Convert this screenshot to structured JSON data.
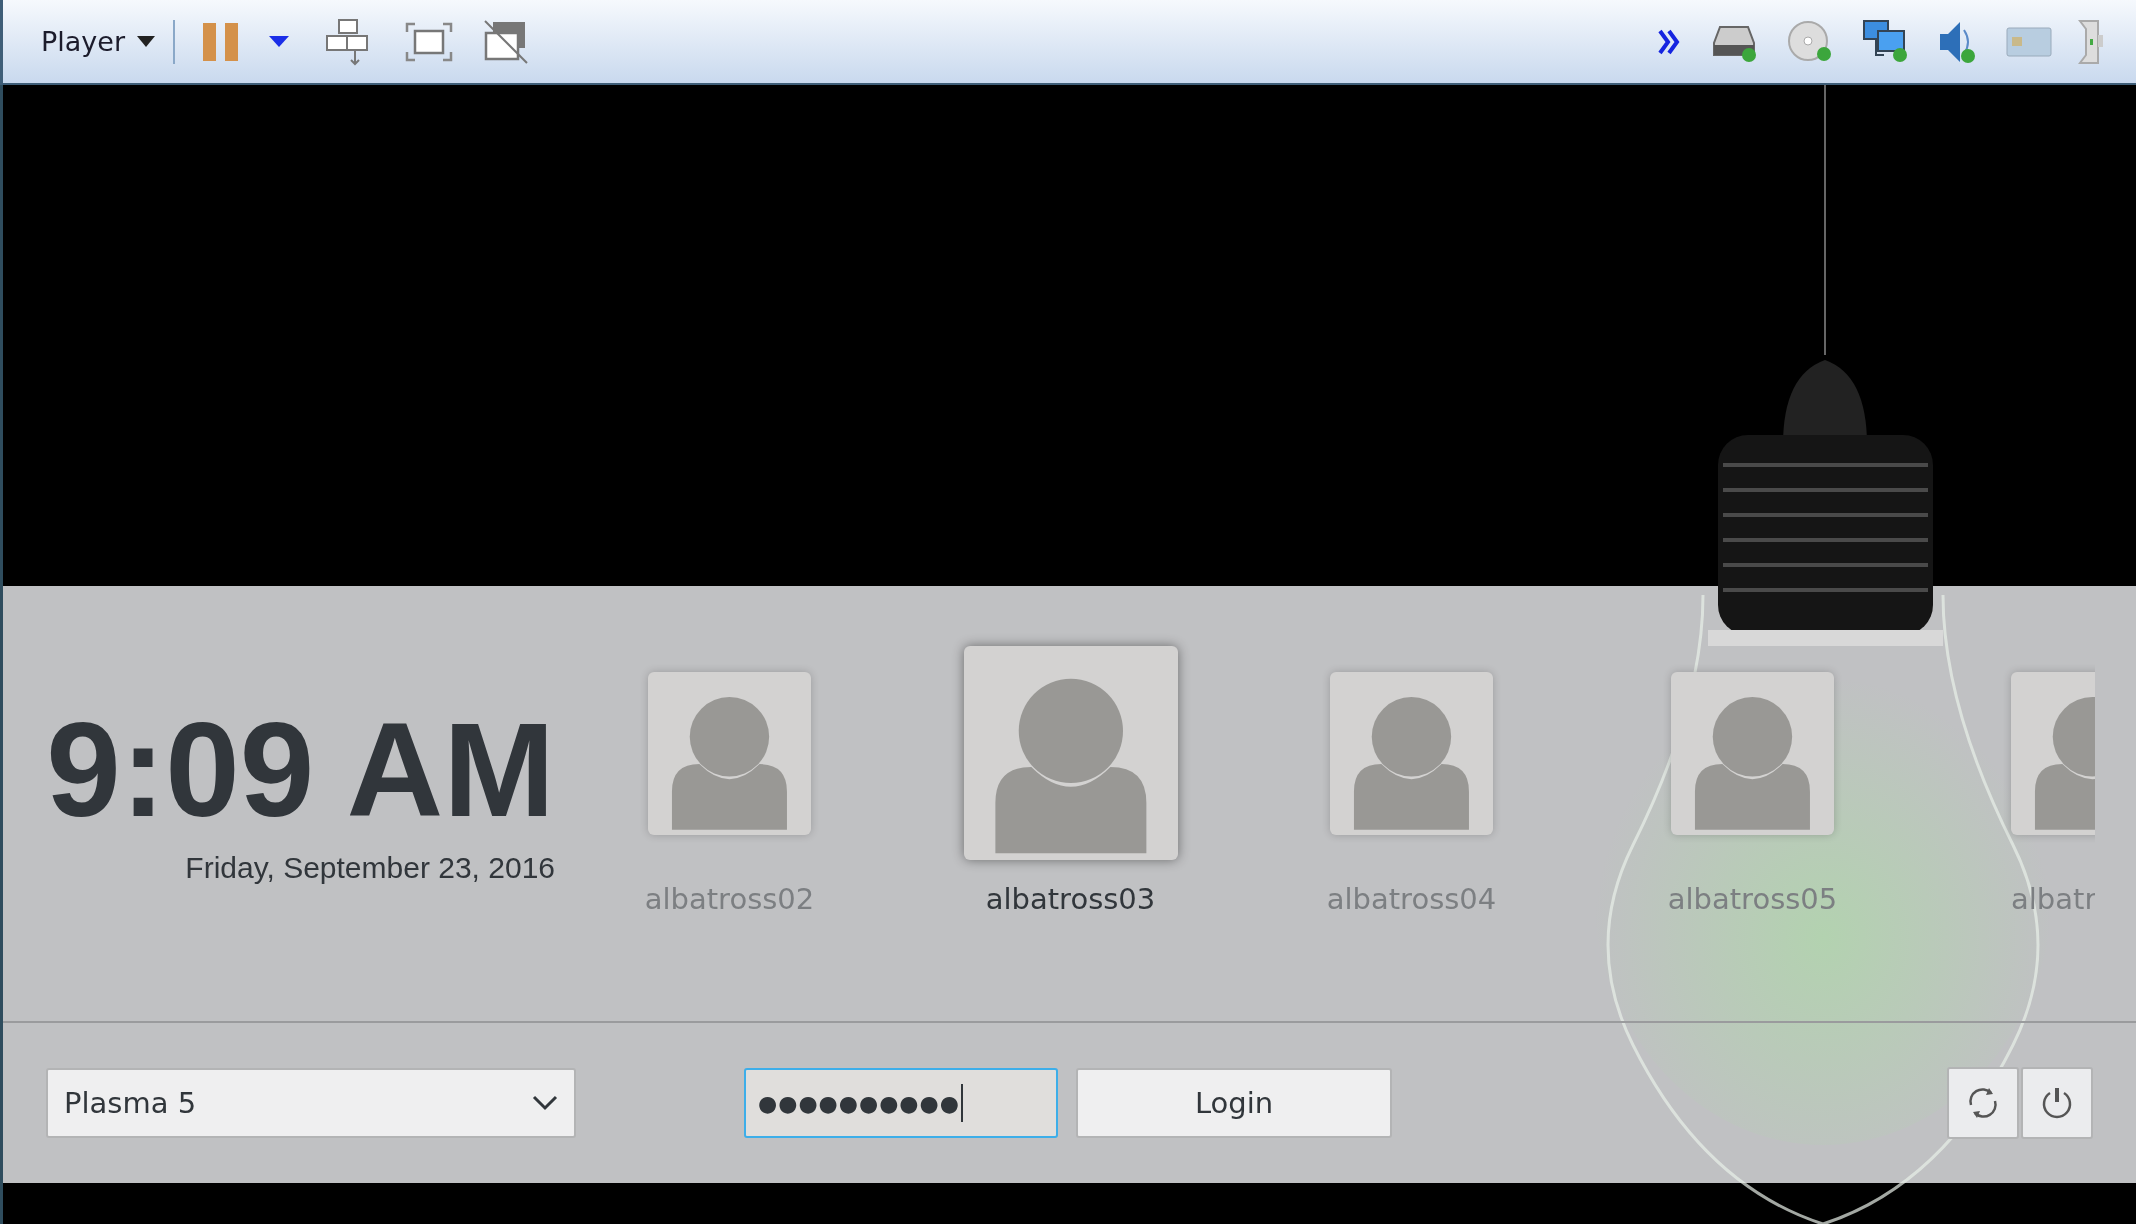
{
  "toolbar": {
    "menu": "Player",
    "paused": true
  },
  "clock": {
    "time": "9:09 AM",
    "date": "Friday, September 23, 2016"
  },
  "users": [
    {
      "name": "albatross02",
      "selected": false
    },
    {
      "name": "albatross03",
      "selected": true
    },
    {
      "name": "albatross04",
      "selected": false
    },
    {
      "name": "albatross05",
      "selected": false
    },
    {
      "name": "albatr",
      "selected": false
    }
  ],
  "session": {
    "value": "Plasma 5"
  },
  "password": {
    "value": "●●●●●●●●●●",
    "focused": true
  },
  "login_button": "Login"
}
